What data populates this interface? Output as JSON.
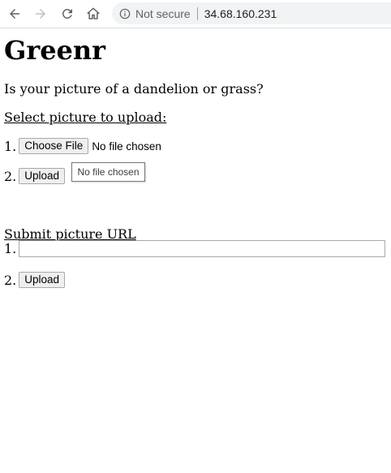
{
  "browser": {
    "back_icon": "arrow-left-icon",
    "forward_icon": "arrow-right-icon",
    "reload_icon": "reload-icon",
    "home_icon": "home-icon",
    "security_label": "Not secure",
    "url": "34.68.160.231"
  },
  "page": {
    "title": "Greenr",
    "question": "Is your picture of a dandelion or grass?",
    "file_section": {
      "heading": "Select picture to upload:",
      "step1_num": "1.",
      "choose_file_label": "Choose File",
      "file_status": "No file chosen",
      "step2_num": "2.",
      "upload_label": "Upload",
      "tooltip": "No file chosen"
    },
    "url_section": {
      "heading": "Submit picture URL",
      "step1_num": "1.",
      "url_value": "",
      "step2_num": "2.",
      "upload_label": "Upload"
    }
  }
}
